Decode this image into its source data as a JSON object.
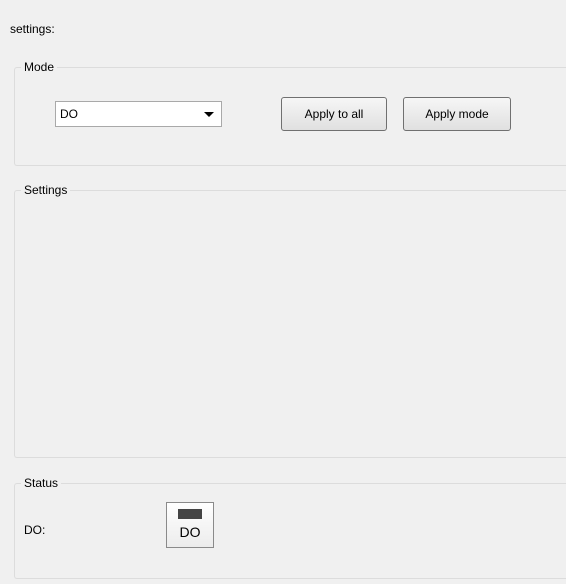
{
  "header": {
    "title": "settings:"
  },
  "mode_group": {
    "legend": "Mode",
    "mode_select": {
      "value": "DO"
    },
    "apply_to_all_label": "Apply to all",
    "apply_mode_label": "Apply mode"
  },
  "settings_group": {
    "legend": "Settings"
  },
  "status_group": {
    "legend": "Status",
    "do_label": "DO:",
    "do_indicator": {
      "text": "DO",
      "led_color": "#444444"
    }
  }
}
